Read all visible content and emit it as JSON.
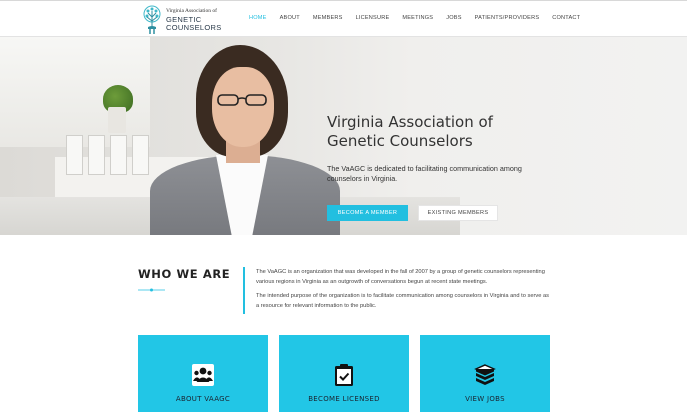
{
  "logo": {
    "line1": "Virginia Association of",
    "line2": "GENETIC",
    "line3": "COUNSELORS"
  },
  "nav": {
    "items": [
      {
        "label": "HOME",
        "active": true
      },
      {
        "label": "ABOUT",
        "active": false
      },
      {
        "label": "MEMBERS",
        "active": false
      },
      {
        "label": "LICENSURE",
        "active": false
      },
      {
        "label": "MEETINGS",
        "active": false
      },
      {
        "label": "JOBS",
        "active": false
      },
      {
        "label": "PATIENTS/PROVIDERS",
        "active": false
      },
      {
        "label": "CONTACT",
        "active": false
      }
    ]
  },
  "hero": {
    "title_line1": "Virginia Association of",
    "title_line2": "Genetic Counselors",
    "subtitle": "The VaAGC is dedicated to facilitating communication among counselors in Virginia.",
    "primary_button": "BECOME A MEMBER",
    "secondary_button": "EXISTING MEMBERS"
  },
  "who": {
    "title": "WHO WE ARE",
    "paragraph1": "The VaAGC is an organization that was developed in the fall of 2007 by a group of genetic counselors representing various regions in Virginia as an outgrowth of conversations begun at recent state meetings.",
    "paragraph2": "The intended purpose of the organization is to facilitate communication among counselors in Virginia and to serve as a resource for relevant information to the public."
  },
  "cards": [
    {
      "label": "ABOUT VAAGC",
      "icon": "group-icon"
    },
    {
      "label": "BECOME LICENSED",
      "icon": "clipboard-check-icon"
    },
    {
      "label": "VIEW JOBS",
      "icon": "stack-icon"
    }
  ],
  "colors": {
    "accent": "#22bfe0",
    "card": "#22c6e6",
    "text": "#333333"
  }
}
